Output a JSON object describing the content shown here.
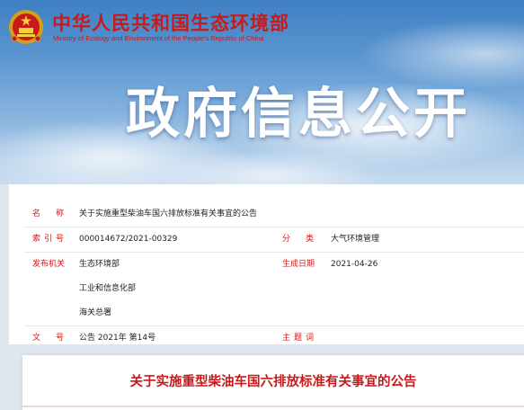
{
  "header": {
    "ministry_name_cn": "中华人民共和国生态环境部",
    "ministry_name_en": "Ministry of Ecology and Environment of the People's Republic of China",
    "emblem_icon": "national-emblem-icon",
    "banner_title": "政府信息公开"
  },
  "meta": {
    "name_label": "名　称",
    "name_value": "关于实施重型柴油车国六排放标准有关事宜的公告",
    "index_label": "索引号",
    "index_value": "000014672/2021-00329",
    "category_label": "分　类",
    "category_value": "大气环境管理",
    "issuer_label": "发布机关",
    "issuers": [
      "生态环境部",
      "工业和信息化部",
      "海关总署"
    ],
    "date_label": "生成日期",
    "date_value": "2021-04-26",
    "docno_label": "文　号",
    "docno_value": "公告 2021年 第14号",
    "keywords_label": "主题词",
    "keywords_value": ""
  },
  "document": {
    "title": "关于实施重型柴油车国六排放标准有关事宜的公告"
  },
  "colors": {
    "brand_red": "#c81a1a",
    "sky_blue": "#3f7fc3"
  }
}
